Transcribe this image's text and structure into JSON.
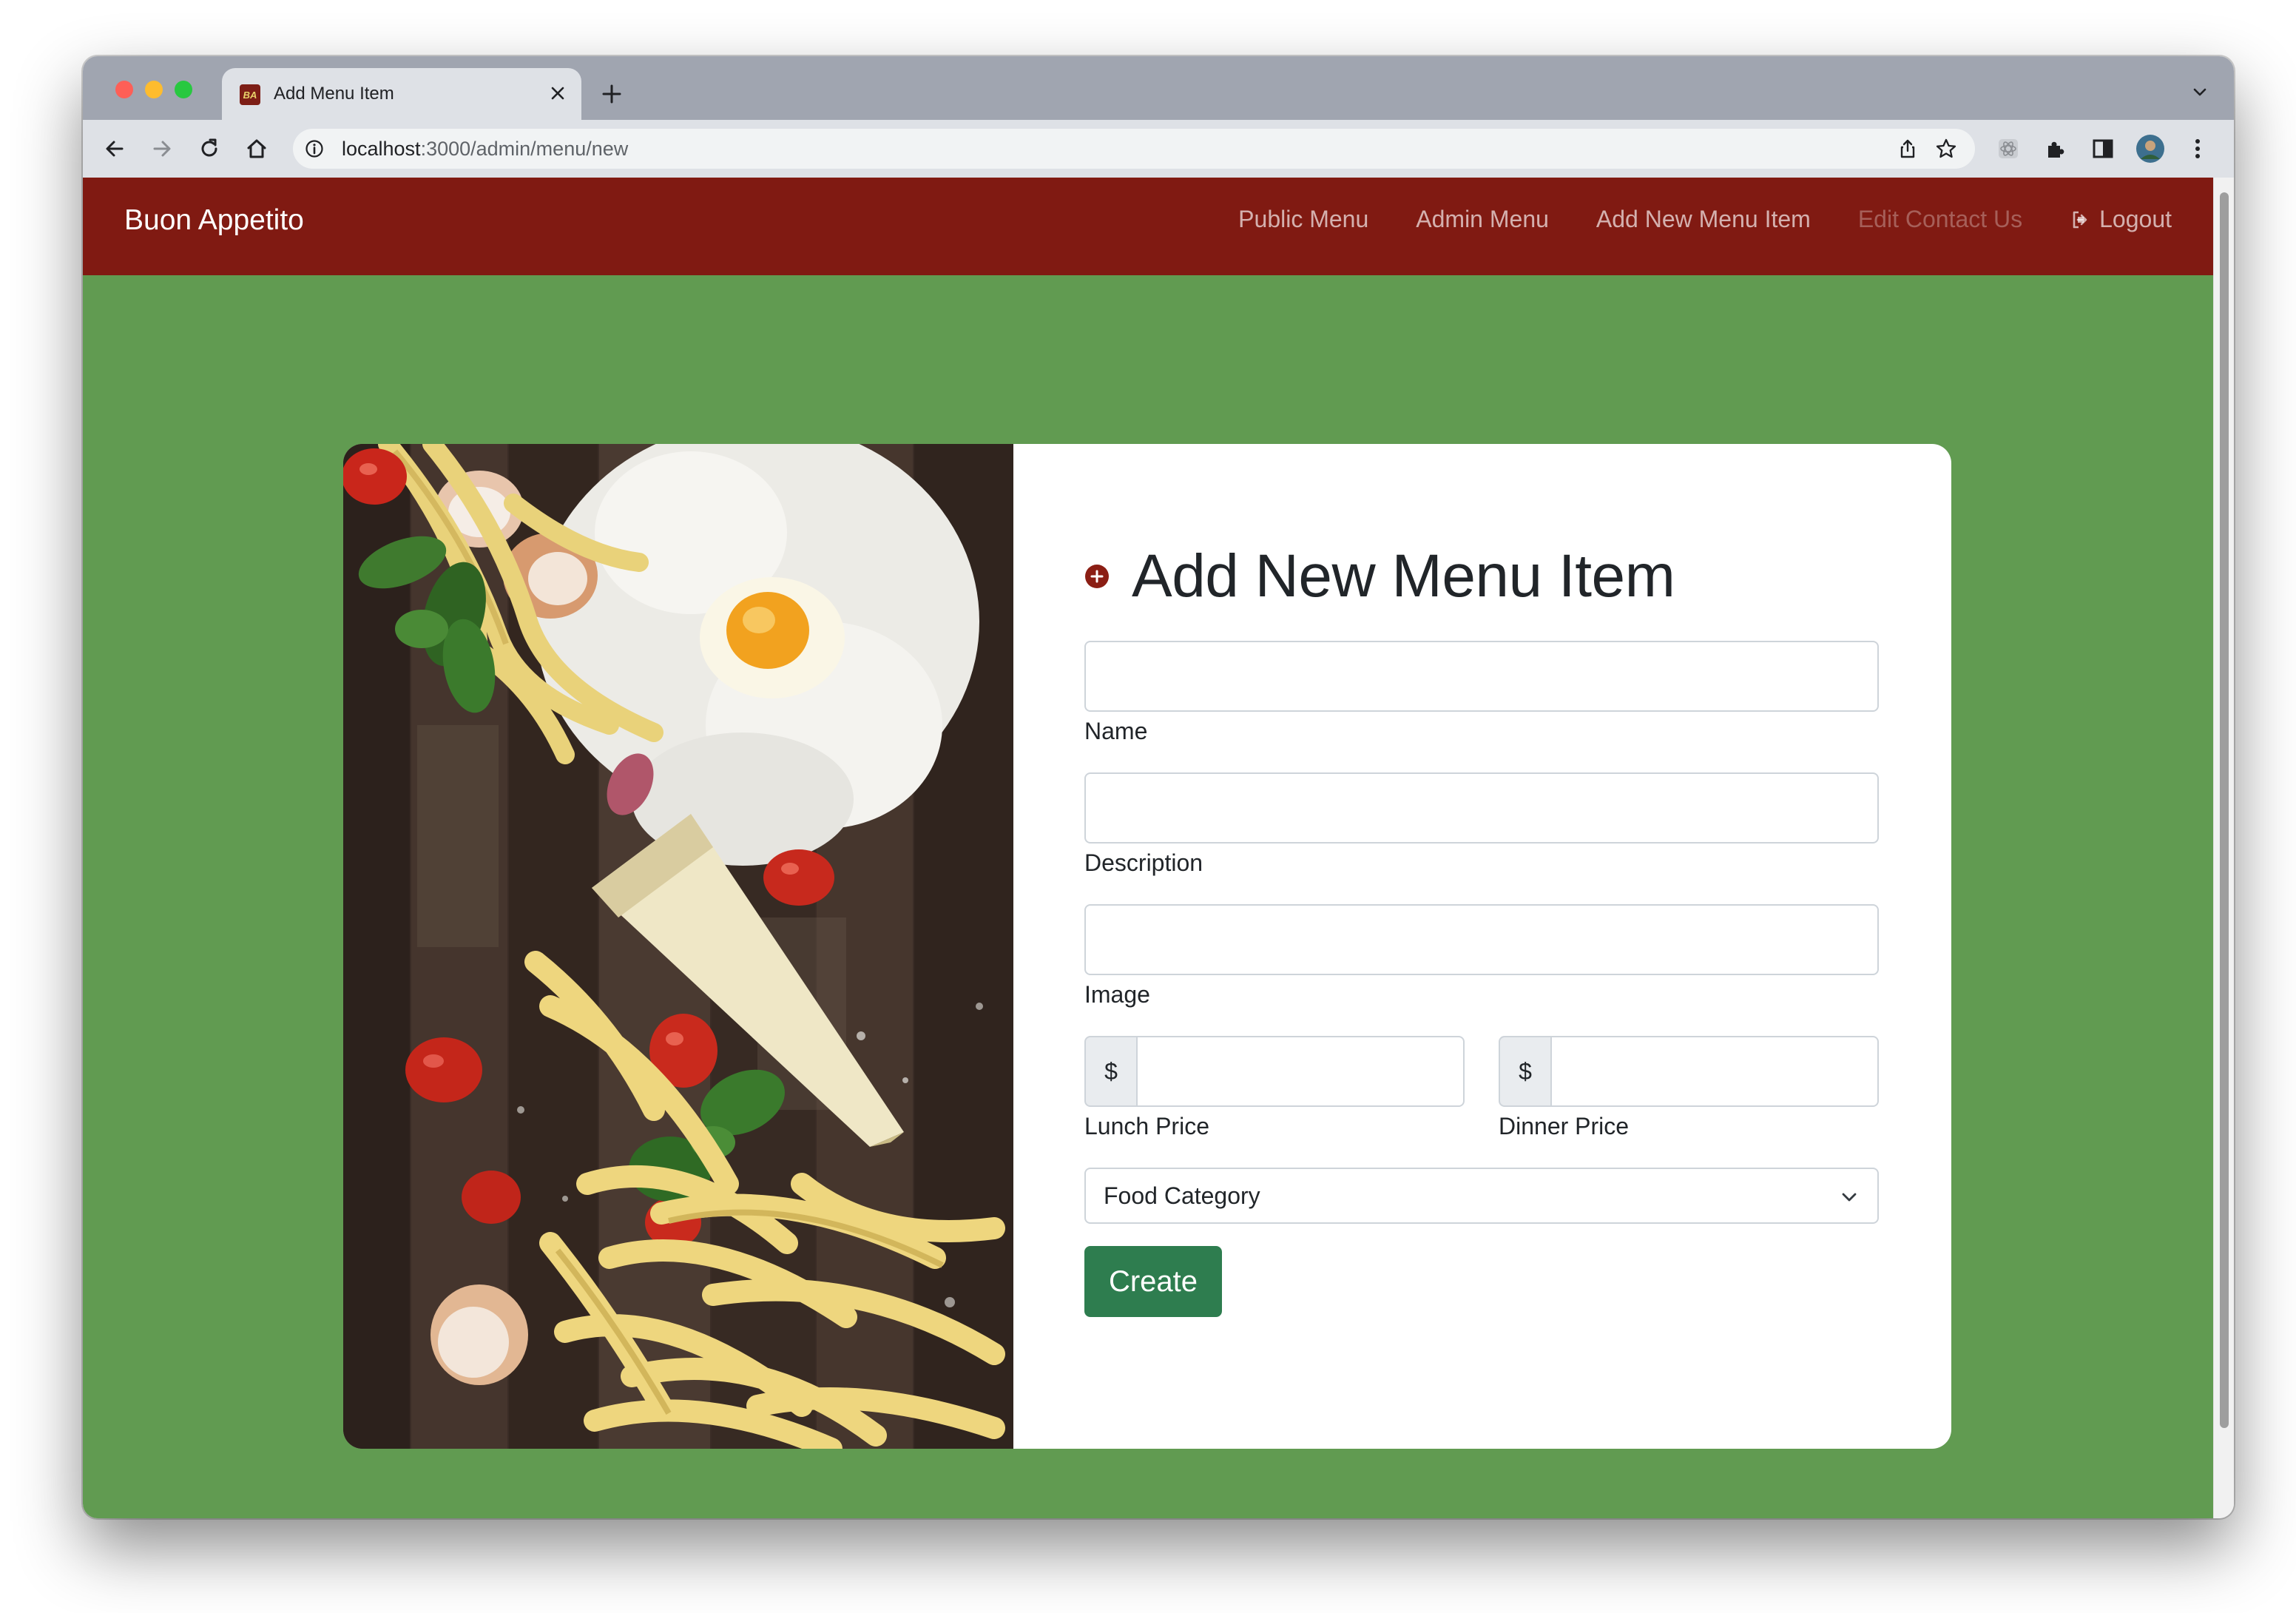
{
  "browser": {
    "tab_title": "Add Menu Item",
    "favicon_text": "BA",
    "url_host": "localhost",
    "url_path": ":3000/admin/menu/new"
  },
  "navbar": {
    "brand": "Buon Appetito",
    "links": [
      {
        "label": "Public Menu",
        "state": "normal"
      },
      {
        "label": "Admin Menu",
        "state": "normal"
      },
      {
        "label": "Add New Menu Item",
        "state": "normal"
      },
      {
        "label": "Edit Contact Us",
        "state": "disabled"
      },
      {
        "label": "Logout",
        "state": "normal",
        "icon": "logout-icon"
      }
    ]
  },
  "form": {
    "heading": "Add New Menu Item",
    "fields": {
      "name": {
        "label": "Name",
        "value": ""
      },
      "description": {
        "label": "Description",
        "value": ""
      },
      "image": {
        "label": "Image",
        "value": ""
      },
      "lunch_price": {
        "label": "Lunch Price",
        "prefix": "$",
        "value": ""
      },
      "dinner_price": {
        "label": "Dinner Price",
        "prefix": "$",
        "value": ""
      }
    },
    "category_select": {
      "selected": "Food Category"
    },
    "submit_label": "Create"
  },
  "colors": {
    "navbar": "#801a12",
    "page_background": "#619b51",
    "create_button": "#2e7d4f",
    "heading_icon": "#8b1e14"
  }
}
